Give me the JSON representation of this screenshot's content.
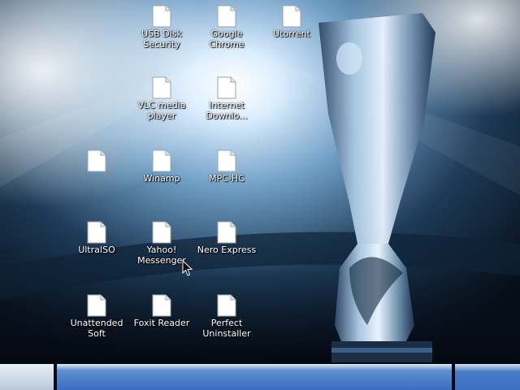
{
  "desktop": {
    "icons": [
      {
        "id": "usb-disk-security",
        "label": "USB Disk\nSecurity"
      },
      {
        "id": "google-chrome",
        "label": "Google Chrome"
      },
      {
        "id": "utorrent",
        "label": "Utorrent"
      },
      {
        "id": "vlc-media-player",
        "label": "VLC media\nplayer"
      },
      {
        "id": "internet-download-manager",
        "label": "Internet\nDownlo..."
      },
      {
        "id": "unnamed",
        "label": ""
      },
      {
        "id": "winamp",
        "label": "Winamp"
      },
      {
        "id": "mpc-hc",
        "label": "MPC-HC"
      },
      {
        "id": "ultraiso",
        "label": "UltraISO"
      },
      {
        "id": "yahoo-messenger",
        "label": "Yahoo!\nMessenger"
      },
      {
        "id": "nero-express",
        "label": "Nero Express"
      },
      {
        "id": "unattended-soft",
        "label": "Unattended\nSoft"
      },
      {
        "id": "foxit-reader",
        "label": "Foxit Reader"
      },
      {
        "id": "perfect-uninstaller",
        "label": "Perfect\nUninstaller"
      }
    ]
  },
  "colors": {
    "label_text": "#ffffff",
    "taskbar_blue": "#3a6ec0",
    "wallpaper_dark": "#06101c",
    "wallpaper_light": "#d9ecff"
  }
}
